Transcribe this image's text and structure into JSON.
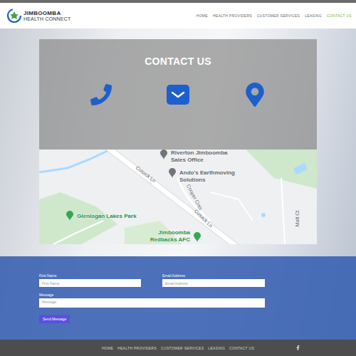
{
  "header": {
    "logo": {
      "name": "JIMBOOMBA",
      "tagline": "HEALTH CONNECT"
    },
    "nav": [
      {
        "label": "HOME",
        "selected": false
      },
      {
        "label": "HEALTH PROVIDERS",
        "selected": false
      },
      {
        "label": "CUSTOMER SERVICES",
        "selected": false
      },
      {
        "label": "LEASING",
        "selected": false
      },
      {
        "label": "CONTACT US",
        "selected": true
      }
    ]
  },
  "contact": {
    "title": "CONTACT US"
  },
  "map": {
    "labels": [
      {
        "text": "Riverton Jimboomba Sales Office",
        "kind": "place"
      },
      {
        "text": "Ando's Earthmoving Solutions",
        "kind": "place"
      },
      {
        "text": "Cusack Ln",
        "kind": "road"
      },
      {
        "text": "Cooper Cres",
        "kind": "road"
      },
      {
        "text": "Cusack Ln",
        "kind": "road"
      },
      {
        "text": "Glenlogan Lakes Park",
        "kind": "park"
      },
      {
        "text": "Jimboomba Redbacks AFC",
        "kind": "venue"
      },
      {
        "text": "Matt Ct",
        "kind": "road"
      }
    ]
  },
  "form": {
    "fields": [
      {
        "label": "First Name",
        "placeholder": "First Name",
        "kind": "input"
      },
      {
        "label": "Email Address",
        "placeholder": "Email Address",
        "kind": "input"
      },
      {
        "label": "Message",
        "placeholder": "Message",
        "kind": "textarea"
      }
    ],
    "button": "Send Message"
  },
  "footer": {
    "nav": [
      "HOME",
      "HEALTH PROVIDERS",
      "CUSTOMER SERVICES",
      "LEASING",
      "CONTACT US"
    ]
  }
}
